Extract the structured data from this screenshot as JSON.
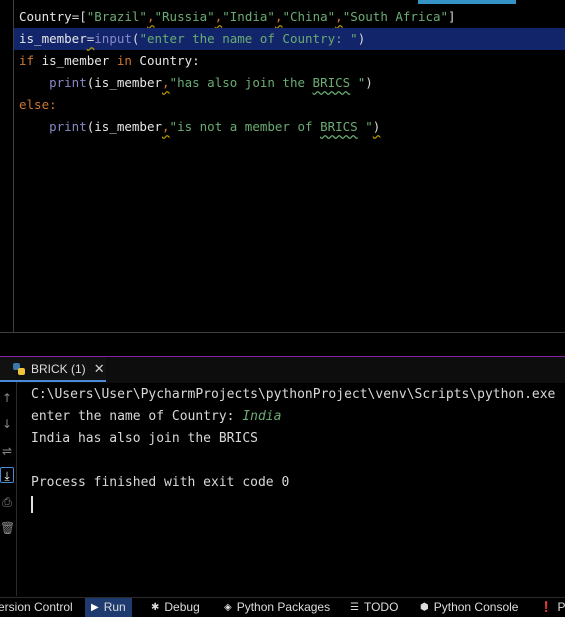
{
  "editor": {
    "lines": [
      {
        "tokens": [
          {
            "t": "Country",
            "c": "tok-ident"
          },
          {
            "t": "=",
            "c": "tok-op"
          },
          {
            "t": "[",
            "c": "tok-op"
          },
          {
            "t": "\"Brazil\"",
            "c": "tok-str"
          },
          {
            "t": ",",
            "c": "tok-comma"
          },
          {
            "t": "\"Russia\"",
            "c": "tok-str"
          },
          {
            "t": ",",
            "c": "tok-comma"
          },
          {
            "t": "\"India\"",
            "c": "tok-str"
          },
          {
            "t": ",",
            "c": "tok-comma"
          },
          {
            "t": "\"China\"",
            "c": "tok-str"
          },
          {
            "t": ",",
            "c": "tok-comma"
          },
          {
            "t": "\"South Africa\"",
            "c": "tok-str"
          },
          {
            "t": "]",
            "c": "tok-op"
          }
        ]
      },
      {
        "current": true,
        "tokens": [
          {
            "t": "is_member",
            "c": "tok-ident"
          },
          {
            "t": "=",
            "c": "tok-op tok-warn-eq"
          },
          {
            "t": "input",
            "c": "tok-fn"
          },
          {
            "t": "(",
            "c": "tok-op"
          },
          {
            "t": "\"enter the name of Country: \"",
            "c": "tok-str"
          },
          {
            "t": ")",
            "c": "tok-op"
          }
        ]
      },
      {
        "tokens": [
          {
            "t": "if ",
            "c": "tok-kw"
          },
          {
            "t": "is_member ",
            "c": "tok-ident"
          },
          {
            "t": "in ",
            "c": "tok-kw"
          },
          {
            "t": "Country:",
            "c": "tok-ident"
          }
        ]
      },
      {
        "tokens": [
          {
            "t": "    ",
            "c": "tok-ident"
          },
          {
            "t": "print",
            "c": "tok-fn"
          },
          {
            "t": "(is_member",
            "c": "tok-ident"
          },
          {
            "t": ",",
            "c": "tok-comma"
          },
          {
            "t": "\"has also join the ",
            "c": "tok-str"
          },
          {
            "t": "BRICS",
            "c": "tok-str tok-typo"
          },
          {
            "t": " \"",
            "c": "tok-str"
          },
          {
            "t": ")",
            "c": "tok-op"
          }
        ]
      },
      {
        "tokens": [
          {
            "t": "else:",
            "c": "tok-kw"
          }
        ]
      },
      {
        "tokens": [
          {
            "t": "    ",
            "c": "tok-ident"
          },
          {
            "t": "print",
            "c": "tok-fn"
          },
          {
            "t": "(is_member",
            "c": "tok-ident"
          },
          {
            "t": ",",
            "c": "tok-comma"
          },
          {
            "t": "\"is not a member of ",
            "c": "tok-str"
          },
          {
            "t": "BRICS",
            "c": "tok-str tok-typo"
          },
          {
            "t": " \"",
            "c": "tok-str"
          },
          {
            "t": ")",
            "c": "tok-op tok-warn-eq"
          }
        ]
      }
    ]
  },
  "run_panel": {
    "tab_label": "BRICK (1)",
    "close_glyph": "✕",
    "tools": {
      "up": "↑",
      "down": "↓",
      "wrap": "⇌",
      "scroll_end": "⤓",
      "print": "⎙",
      "trash": "🗑"
    },
    "console": {
      "command": "C:\\Users\\User\\PycharmProjects\\pythonProject\\venv\\Scripts\\python.exe",
      "prompt": "enter the name of Country: ",
      "user_input": "India",
      "output": "India has also join the BRICS",
      "blank": "",
      "exit": "Process finished with exit code 0"
    }
  },
  "statusbar": {
    "items": [
      {
        "label": "ersion Control",
        "icon": ""
      },
      {
        "label": "Run",
        "icon": "▶",
        "active": true
      },
      {
        "label": "Debug",
        "icon": "✱"
      },
      {
        "label": "Python Packages",
        "icon": "◈"
      },
      {
        "label": "TODO",
        "icon": "☰"
      },
      {
        "label": "Python Console",
        "icon": "⬢"
      },
      {
        "label": "Pr",
        "icon": "❗"
      }
    ]
  }
}
